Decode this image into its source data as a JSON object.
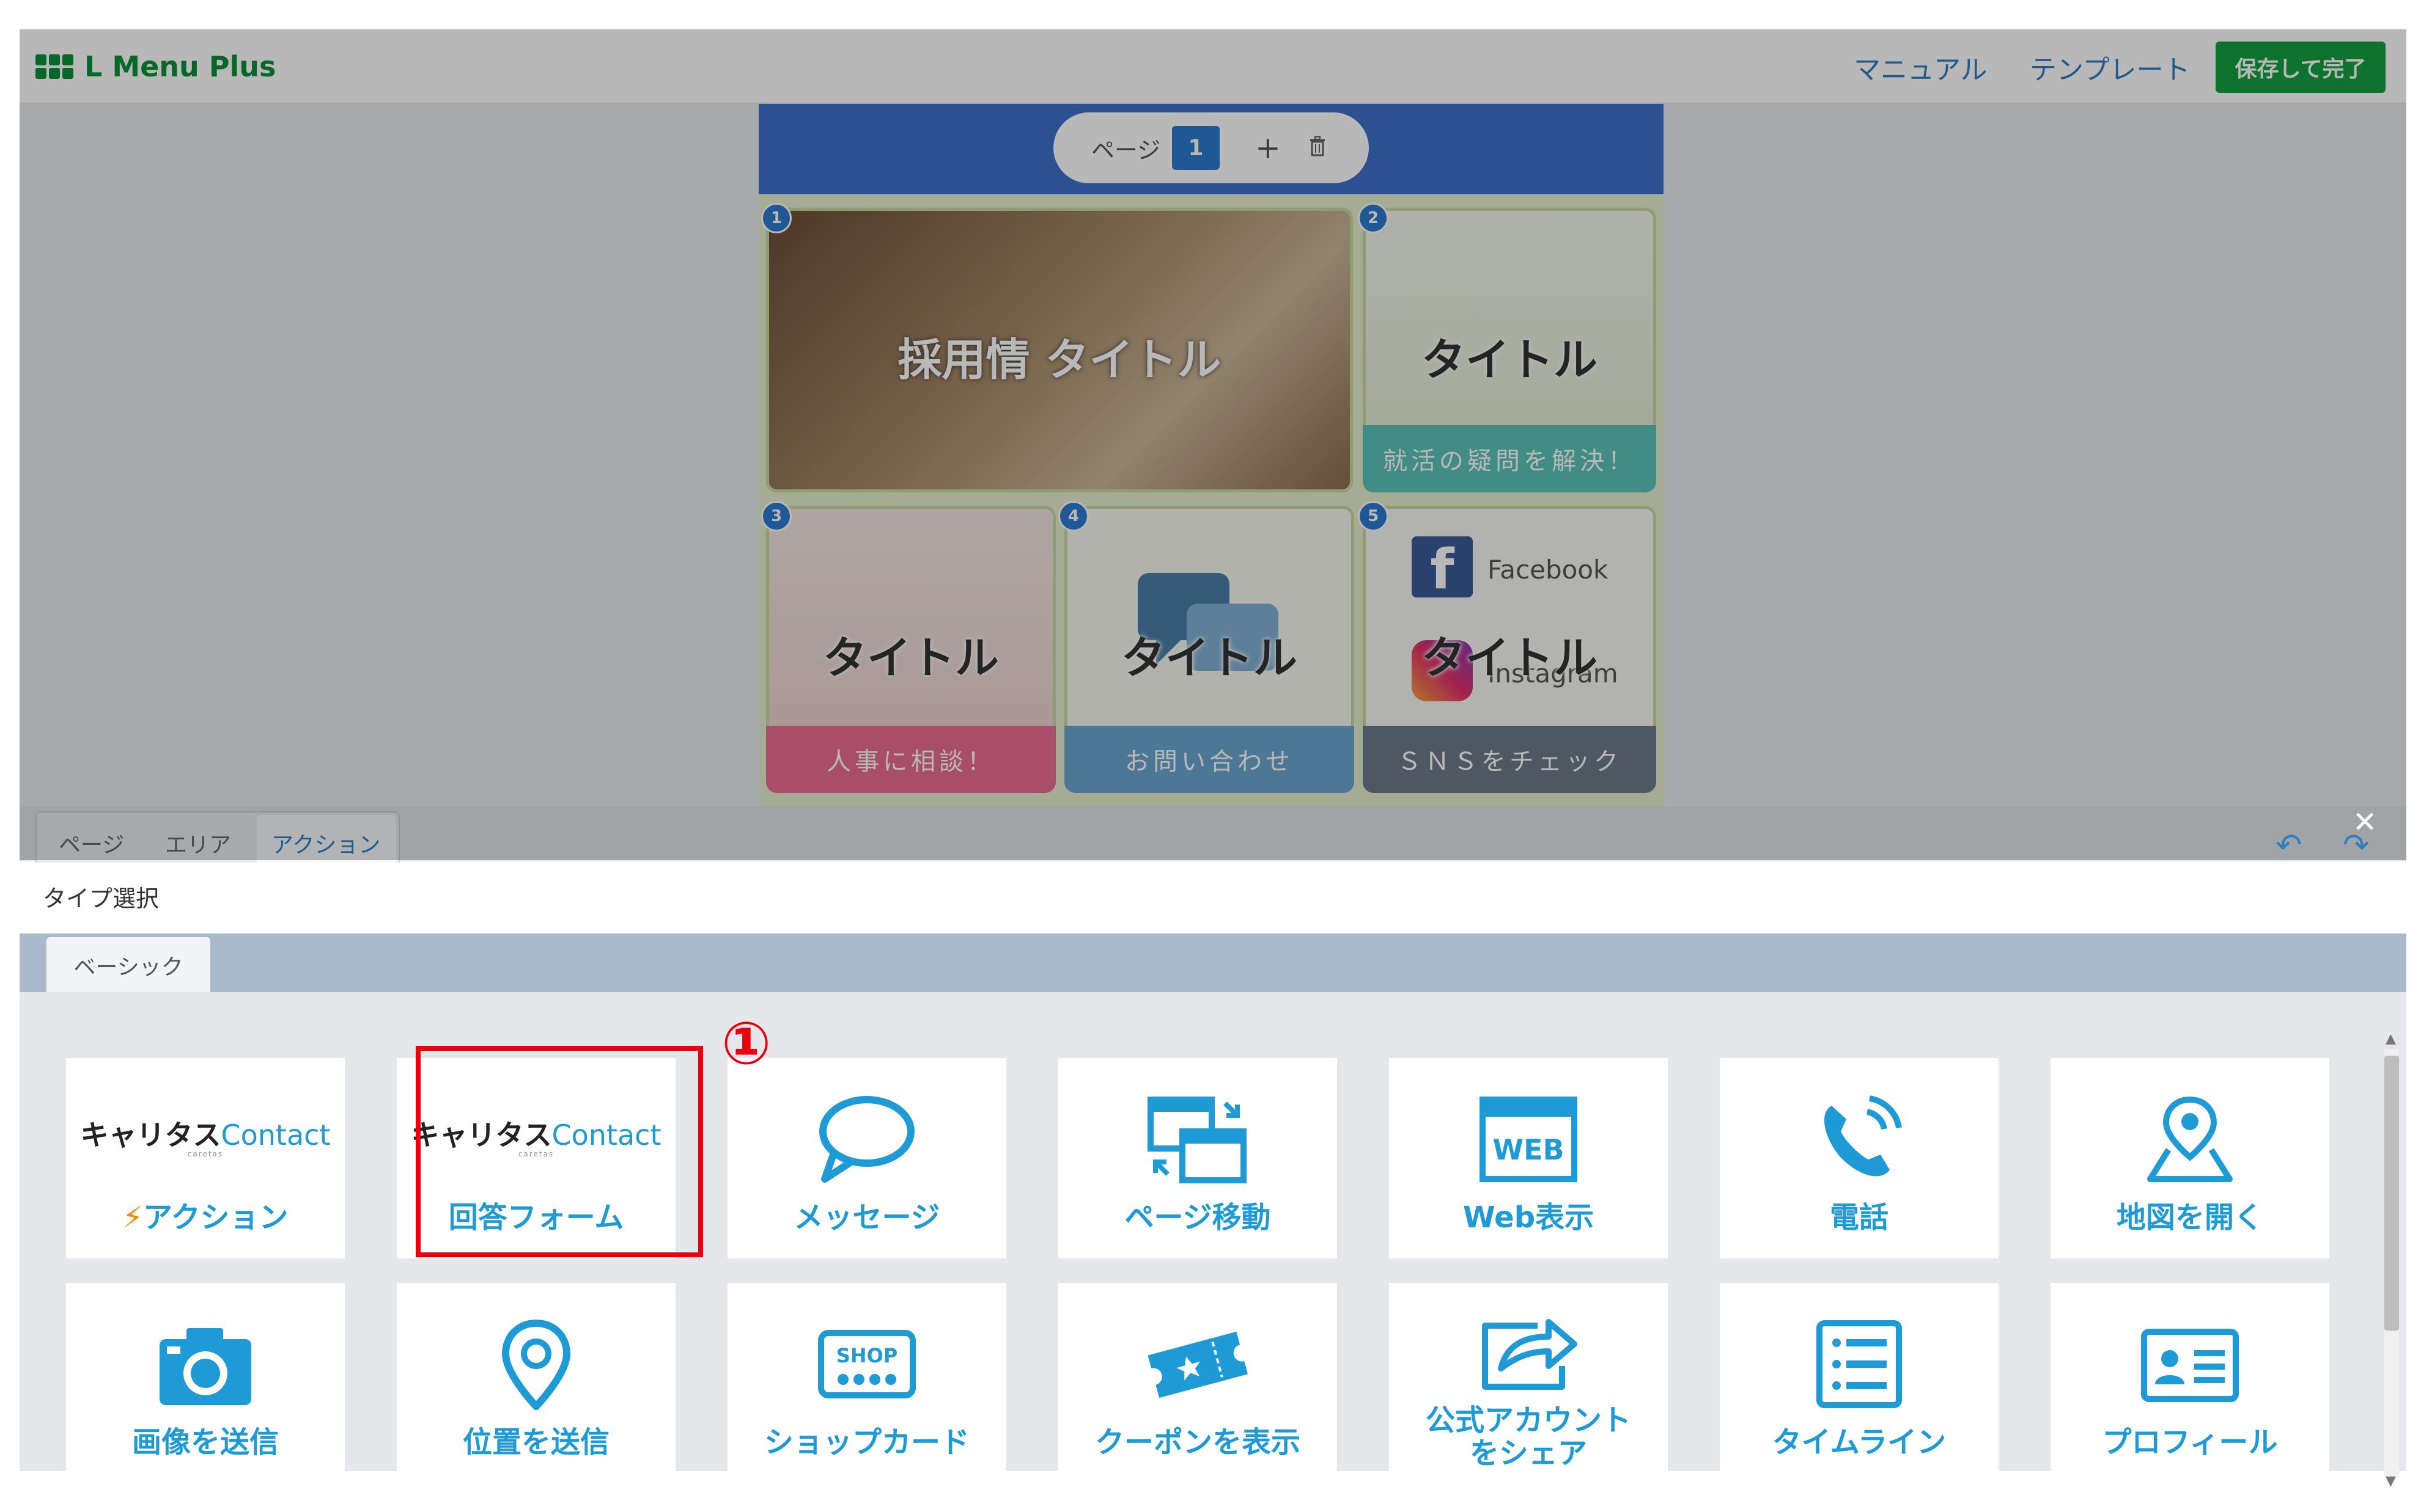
{
  "header": {
    "logo": "L Menu Plus",
    "manual_link": "マニュアル",
    "template_link": "テンプレート",
    "save_button": "保存して完了"
  },
  "editor": {
    "page_label": "ページ",
    "current_page": "1",
    "add_page": "+",
    "cells": [
      {
        "badge": "1",
        "title": "採用情 タイトル",
        "band": ""
      },
      {
        "badge": "2",
        "title": "タイトル",
        "band": "就活の疑問を解決！"
      },
      {
        "badge": "3",
        "title": "タイトル",
        "band": "人事に相談！"
      },
      {
        "badge": "4",
        "title": "タイトル",
        "band": "お問い合わせ"
      },
      {
        "badge": "5",
        "title": "タイトル",
        "band": "ＳＮＳをチェック"
      }
    ],
    "facebook_label": "Facebook",
    "instagram_label": "Instagram"
  },
  "tabs": {
    "page": "ページ",
    "area": "エリア",
    "action": "アクション"
  },
  "panel": {
    "type_select_label": "タイプ選択",
    "category_tab": "ベーシック",
    "marker": "①",
    "brand_main": "キャリタス",
    "brand_contact": "Contact",
    "brand_sub": "caretas",
    "cards": [
      {
        "label": "アクション",
        "prefix": "⚡",
        "icon": "careetas-contact-logo"
      },
      {
        "label": "回答フォーム",
        "icon": "careetas-contact-logo"
      },
      {
        "label": "メッセージ",
        "icon": "speech-bubble-icon"
      },
      {
        "label": "ページ移動",
        "icon": "page-move-icon"
      },
      {
        "label": "Web表示",
        "icon": "web-icon"
      },
      {
        "label": "電話",
        "icon": "phone-icon"
      },
      {
        "label": "地図を開く",
        "icon": "map-icon"
      },
      {
        "label": "画像を送信",
        "icon": "camera-icon"
      },
      {
        "label": "位置を送信",
        "icon": "location-pin-icon"
      },
      {
        "label": "ショップカード",
        "icon": "shop-card-icon"
      },
      {
        "label": "クーポンを表示",
        "icon": "coupon-icon"
      },
      {
        "label": "公式アカウント\nをシェア",
        "icon": "share-icon"
      },
      {
        "label": "タイムライン",
        "icon": "timeline-icon"
      },
      {
        "label": "プロフィール",
        "icon": "profile-icon"
      }
    ],
    "web_icon_text": "WEB",
    "shop_icon_text": "SHOP"
  },
  "colors": {
    "brand_green": "#13a040",
    "accent_blue": "#1e9ad6",
    "highlight_red": "#e8000b"
  }
}
